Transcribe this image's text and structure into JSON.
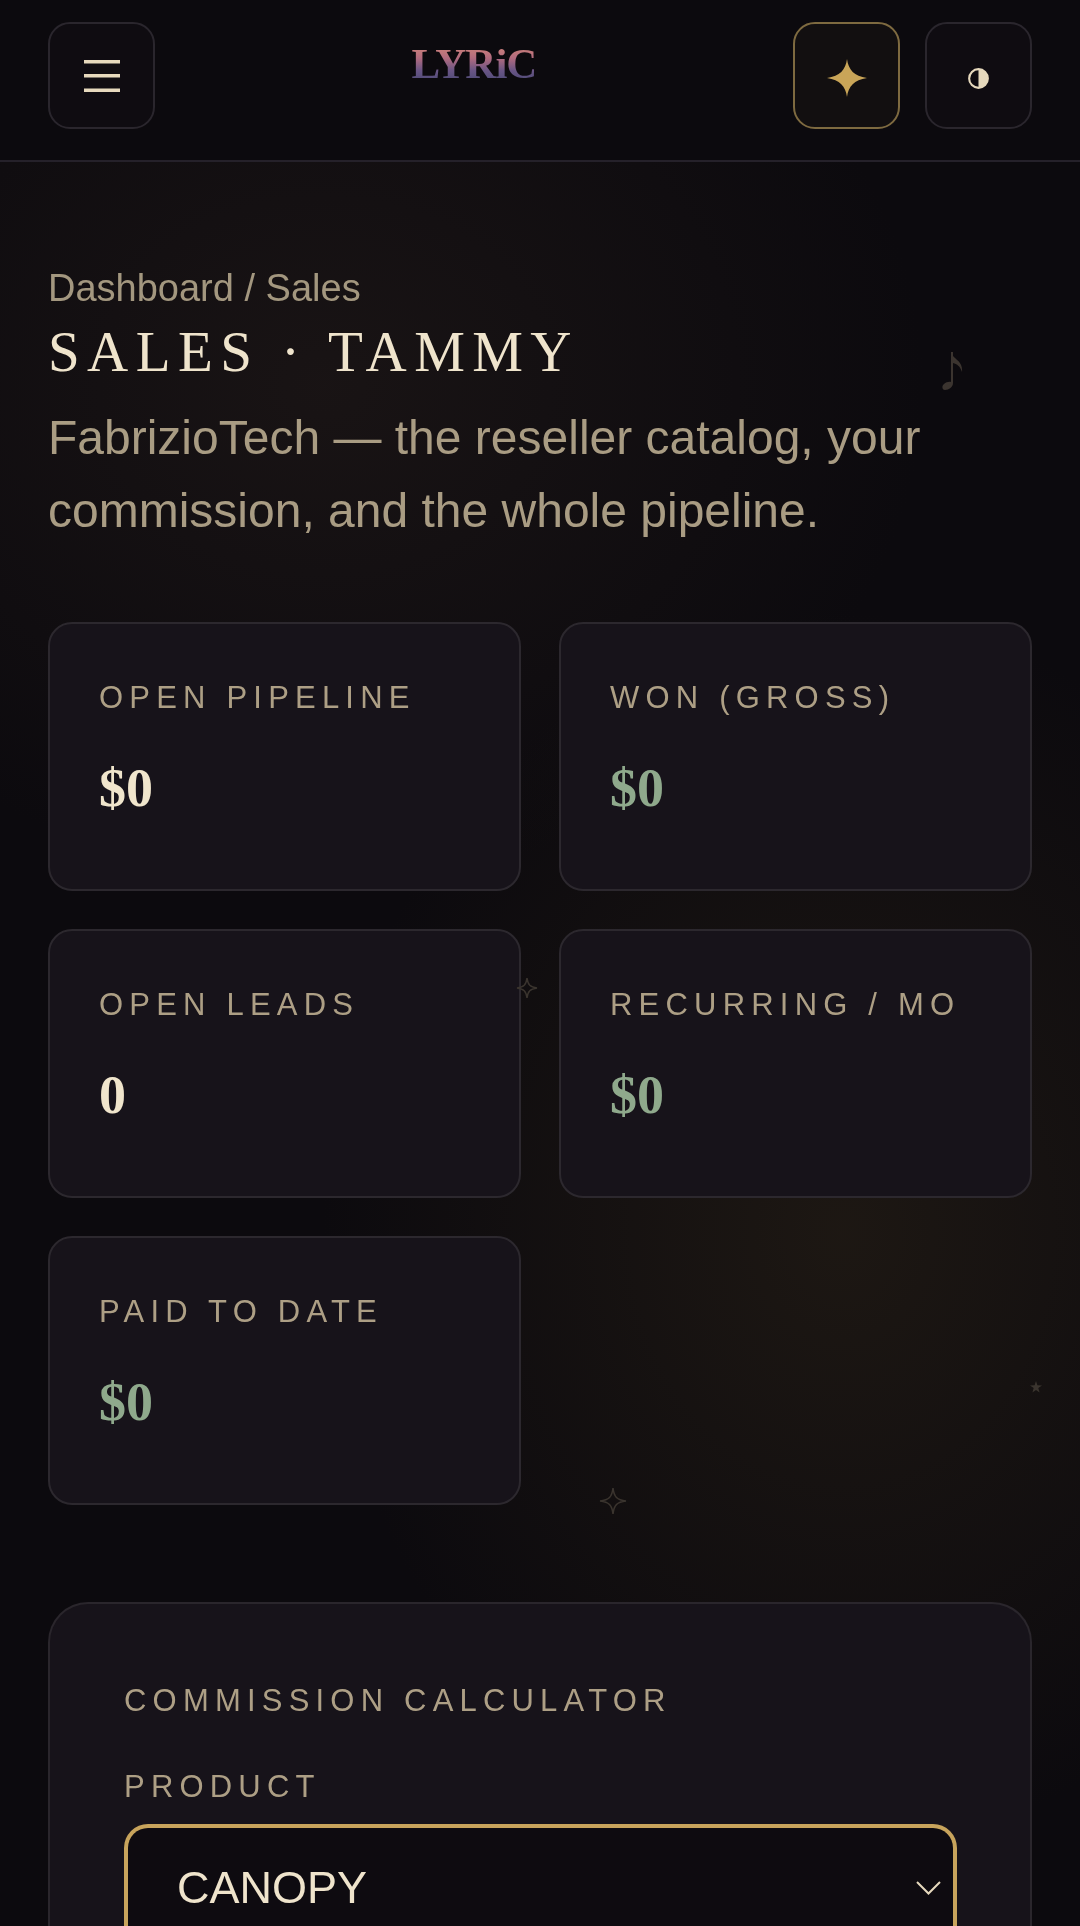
{
  "header": {
    "logo": "LYRiC"
  },
  "breadcrumb": "Dashboard / Sales",
  "title": "SALES · TAMMY",
  "subtitle": "FabrizioTech — the reseller catalog, your commission, and the whole pipeline.",
  "stats": [
    {
      "label": "OPEN PIPELINE",
      "value": "$0",
      "color": "#f0e5cc"
    },
    {
      "label": "WON (GROSS)",
      "value": "$0",
      "color": "#8fa98c"
    },
    {
      "label": "OPEN LEADS",
      "value": "0",
      "color": "#f0e5cc"
    },
    {
      "label": "RECURRING / MO",
      "value": "$0",
      "color": "#8fa98c"
    },
    {
      "label": "PAID TO DATE",
      "value": "$0",
      "color": "#8fa98c"
    }
  ],
  "calculator": {
    "title": "COMMISSION CALCULATOR",
    "product": {
      "label": "PRODUCT",
      "value": "CANOPY"
    }
  }
}
